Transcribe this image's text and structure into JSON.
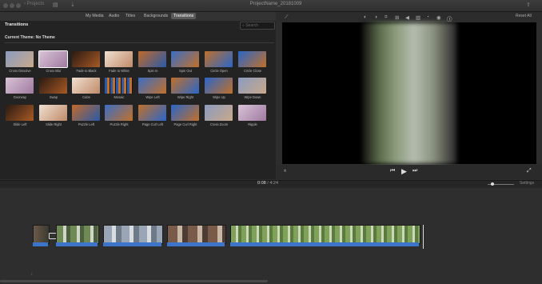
{
  "titlebar": {
    "back_label": "Projects",
    "title": "ProjectName_20181009"
  },
  "tabs": [
    {
      "label": "My Media"
    },
    {
      "label": "Audio"
    },
    {
      "label": "Titles"
    },
    {
      "label": "Backgrounds"
    },
    {
      "label": "Transitions",
      "active": true
    }
  ],
  "browser": {
    "header": "Transitions",
    "search_placeholder": "Search",
    "theme_label": "Current Theme: No Theme",
    "transitions": [
      {
        "label": "Cross Dissolve"
      },
      {
        "label": "Cross Blur",
        "selected": true
      },
      {
        "label": "Fade to Black"
      },
      {
        "label": "Fade to White"
      },
      {
        "label": "Spin In"
      },
      {
        "label": "Spin Out"
      },
      {
        "label": "Circle Open"
      },
      {
        "label": "Circle Close"
      },
      {
        "label": "Doorway"
      },
      {
        "label": "Swap"
      },
      {
        "label": "Cube"
      },
      {
        "label": "Mosaic"
      },
      {
        "label": "Wipe Left"
      },
      {
        "label": "Wipe Right"
      },
      {
        "label": "Wipe Up"
      },
      {
        "label": "Wipe Down"
      },
      {
        "label": "Slide Left"
      },
      {
        "label": "Slide Right"
      },
      {
        "label": "Puzzle Left"
      },
      {
        "label": "Puzzle Right"
      },
      {
        "label": "Page Curl Left"
      },
      {
        "label": "Page Curl Right"
      },
      {
        "label": "Cross Zoom"
      },
      {
        "label": "Ripple"
      }
    ]
  },
  "viewer": {
    "reset_all": "Reset All"
  },
  "timeline": {
    "current_time": "0:08",
    "separator": "/",
    "total_time": "4:24",
    "settings_label": "Settings"
  },
  "colors": {
    "accent_audio": "#3c74c9",
    "bg": "#2d2d2d"
  }
}
